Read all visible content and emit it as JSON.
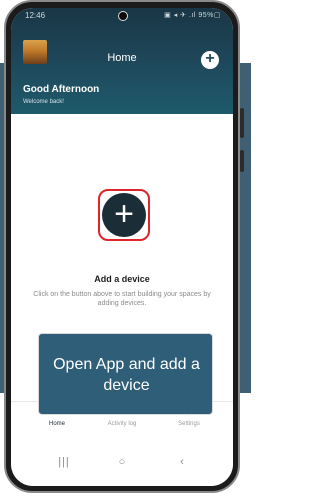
{
  "status_bar": {
    "time": "12:46",
    "icons": "▣ ◂ ✈ .ıl 95%▢"
  },
  "header": {
    "title": "Home",
    "add_icon": "plus-circle-icon",
    "greeting": "Good Afternoon",
    "subgreeting": "Welcome back!"
  },
  "empty_state": {
    "add_icon": "plus-icon",
    "title": "Add a device",
    "description": "Click on the button above to start building your spaces by adding devices."
  },
  "callout": {
    "text": "Open App and add a device"
  },
  "bottom_nav": {
    "items": [
      {
        "label": "Home",
        "icon": "home-icon"
      },
      {
        "label": "Activity log",
        "icon": "activity-log-icon"
      },
      {
        "label": "Settings",
        "icon": "settings-icon"
      }
    ]
  },
  "system_nav": {
    "recent": "|||",
    "home": "○",
    "back": "‹"
  },
  "colors": {
    "header_dark": "#193645",
    "accent_red": "#e0242b",
    "callout_bg": "#2f5e78",
    "backdrop": "#3f5f73"
  }
}
